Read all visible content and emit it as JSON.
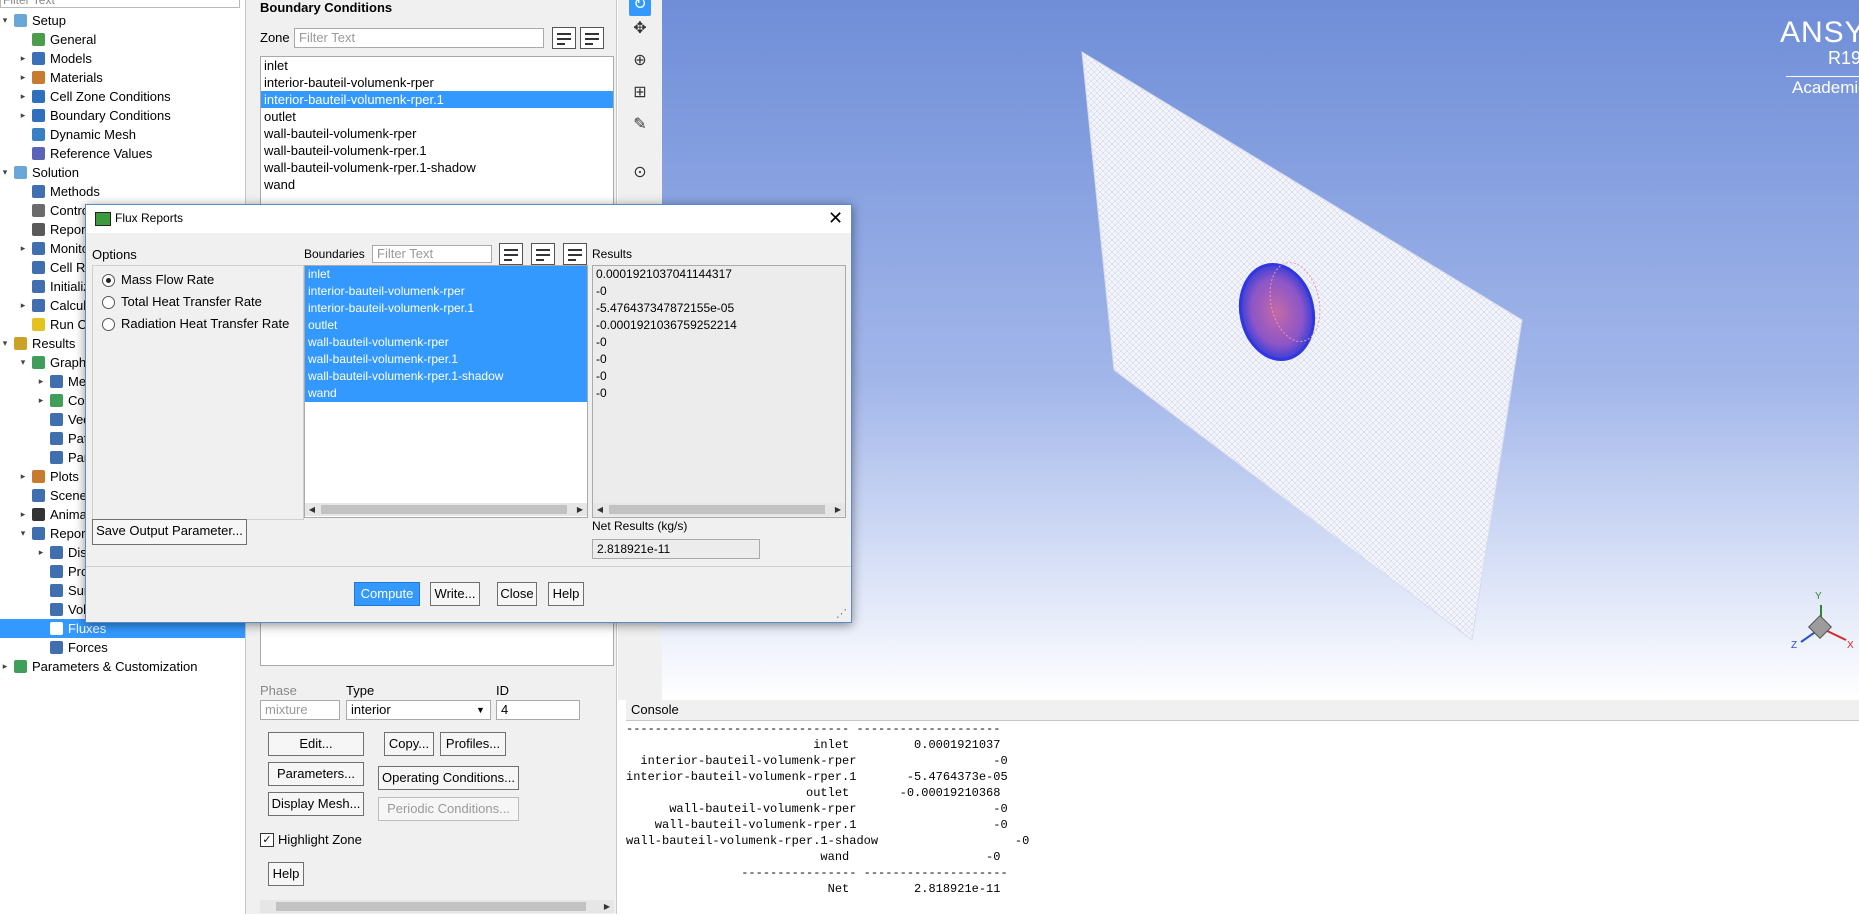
{
  "tree": {
    "filter_placeholder": "Filter Text",
    "items": [
      {
        "label": "Setup",
        "level": 0,
        "arrow": "▾",
        "color": "#6aa6d8",
        "selected": false
      },
      {
        "label": "General",
        "level": 1,
        "arrow": "",
        "color": "#4b9d4b",
        "selected": false
      },
      {
        "label": "Models",
        "level": 1,
        "arrow": "▸",
        "color": "#3b6fb8",
        "selected": false
      },
      {
        "label": "Materials",
        "level": 1,
        "arrow": "▸",
        "color": "#c77b30",
        "selected": false
      },
      {
        "label": "Cell Zone Conditions",
        "level": 1,
        "arrow": "▸",
        "color": "#2f6fbe",
        "selected": false
      },
      {
        "label": "Boundary Conditions",
        "level": 1,
        "arrow": "▸",
        "color": "#2f6fbe",
        "selected": false
      },
      {
        "label": "Dynamic Mesh",
        "level": 1,
        "arrow": "",
        "color": "#3a7fc4",
        "selected": false
      },
      {
        "label": "Reference Values",
        "level": 1,
        "arrow": "",
        "color": "#5a63b8",
        "selected": false
      },
      {
        "label": "Solution",
        "level": 0,
        "arrow": "▾",
        "color": "#6aa6d8",
        "selected": false
      },
      {
        "label": "Methods",
        "level": 1,
        "arrow": "",
        "color": "#3f6fae",
        "selected": false
      },
      {
        "label": "Controls",
        "level": 1,
        "arrow": "",
        "color": "#6b6b6b",
        "selected": false
      },
      {
        "label": "Report Definitions",
        "level": 1,
        "arrow": "",
        "color": "#5a5a5a",
        "selected": false
      },
      {
        "label": "Monitors",
        "level": 1,
        "arrow": "▸",
        "color": "#3f6fae",
        "selected": false
      },
      {
        "label": "Cell Registers",
        "level": 1,
        "arrow": "",
        "color": "#3f6fae",
        "selected": false
      },
      {
        "label": "Initialization",
        "level": 1,
        "arrow": "",
        "color": "#3f6fae",
        "selected": false
      },
      {
        "label": "Calculation Activities",
        "level": 1,
        "arrow": "▸",
        "color": "#3f6fae",
        "selected": false
      },
      {
        "label": "Run Calculation",
        "level": 1,
        "arrow": "",
        "color": "#e6c21e",
        "selected": false
      },
      {
        "label": "Results",
        "level": 0,
        "arrow": "▾",
        "color": "#c9a227",
        "selected": false
      },
      {
        "label": "Graphics",
        "level": 1,
        "arrow": "▾",
        "color": "#3f9e5a",
        "selected": false
      },
      {
        "label": "Mesh",
        "level": 2,
        "arrow": "▸",
        "color": "#3f6fae",
        "selected": false
      },
      {
        "label": "Contours",
        "level": 2,
        "arrow": "▸",
        "color": "#3f9e5a",
        "selected": false
      },
      {
        "label": "Vectors",
        "level": 2,
        "arrow": "",
        "color": "#3f6fae",
        "selected": false
      },
      {
        "label": "Pathlines",
        "level": 2,
        "arrow": "",
        "color": "#3f6fae",
        "selected": false
      },
      {
        "label": "Particle Tracks",
        "level": 2,
        "arrow": "",
        "color": "#3f6fae",
        "selected": false
      },
      {
        "label": "Plots",
        "level": 1,
        "arrow": "▸",
        "color": "#c77b30",
        "selected": false
      },
      {
        "label": "Scene",
        "level": 1,
        "arrow": "",
        "color": "#3f6fae",
        "selected": false
      },
      {
        "label": "Animations",
        "level": 1,
        "arrow": "▸",
        "color": "#333333",
        "selected": false
      },
      {
        "label": "Reports",
        "level": 1,
        "arrow": "▾",
        "color": "#3f6fae",
        "selected": false
      },
      {
        "label": "Discrete Phase",
        "level": 2,
        "arrow": "▸",
        "color": "#3f6fae",
        "selected": false
      },
      {
        "label": "Projected Areas",
        "level": 2,
        "arrow": "",
        "color": "#3f6fae",
        "selected": false
      },
      {
        "label": "Surface Integrals",
        "level": 2,
        "arrow": "",
        "color": "#3f6fae",
        "selected": false
      },
      {
        "label": "Volume Integrals",
        "level": 2,
        "arrow": "",
        "color": "#3f6fae",
        "selected": false
      },
      {
        "label": "Fluxes",
        "level": 2,
        "arrow": "",
        "color": "#ffffff",
        "selected": true
      },
      {
        "label": "Forces",
        "level": 2,
        "arrow": "",
        "color": "#3f6fae",
        "selected": false
      },
      {
        "label": "Parameters & Customization",
        "level": 0,
        "arrow": "▸",
        "color": "#3f9e5a",
        "selected": false
      }
    ]
  },
  "bc_panel": {
    "title": "Boundary Conditions",
    "zone_label": "Zone",
    "filter_placeholder": "Filter Text",
    "zones": [
      {
        "name": "inlet",
        "selected": false
      },
      {
        "name": "interior-bauteil-volumenk-rper",
        "selected": false
      },
      {
        "name": "interior-bauteil-volumenk-rper.1",
        "selected": true
      },
      {
        "name": "outlet",
        "selected": false
      },
      {
        "name": "wall-bauteil-volumenk-rper",
        "selected": false
      },
      {
        "name": "wall-bauteil-volumenk-rper.1",
        "selected": false
      },
      {
        "name": "wall-bauteil-volumenk-rper.1-shadow",
        "selected": false
      },
      {
        "name": "wand",
        "selected": false
      }
    ],
    "phase_label": "Phase",
    "phase_value": "mixture",
    "type_label": "Type",
    "type_value": "interior",
    "id_label": "ID",
    "id_value": "4",
    "edit_button": "Edit...",
    "copy_button": "Copy...",
    "profiles_button": "Profiles...",
    "parameters_button": "Parameters...",
    "operating_conditions_button": "Operating Conditions...",
    "display_mesh_button": "Display Mesh...",
    "periodic_conditions_button": "Periodic Conditions...",
    "highlight_zone_label": "Highlight Zone",
    "highlight_zone_checked": true,
    "help_button": "Help"
  },
  "viewport": {
    "brand": "ANSYS",
    "version": "R19",
    "edition": "Academic",
    "triad_labels": {
      "x": "X",
      "y": "Y",
      "z": "Z"
    }
  },
  "dialog": {
    "title": "Flux Reports",
    "options_label": "Options",
    "options": [
      {
        "label": "Mass Flow Rate",
        "checked": true
      },
      {
        "label": "Total Heat Transfer Rate",
        "checked": false
      },
      {
        "label": "Radiation Heat Transfer Rate",
        "checked": false
      }
    ],
    "boundaries_label": "Boundaries",
    "filter_placeholder": "Filter Text",
    "results_label": "Results",
    "boundaries": [
      "inlet",
      "interior-bauteil-volumenk-rper",
      "interior-bauteil-volumenk-rper.1",
      "outlet",
      "wall-bauteil-volumenk-rper",
      "wall-bauteil-volumenk-rper.1",
      "wall-bauteil-volumenk-rper.1-shadow",
      "wand"
    ],
    "results": [
      "0.0001921037041144317",
      "-0",
      "-5.476437347872155e-05",
      "-0.0001921036759252214",
      "-0",
      "-0",
      "-0",
      "-0"
    ],
    "save_output_button": "Save Output Parameter...",
    "net_results_label": "Net Results (kg/s)",
    "net_results_value": "2.818921e-11",
    "compute_button": "Compute",
    "write_button": "Write...",
    "close_button": "Close",
    "help_button": "Help"
  },
  "console": {
    "title": "Console",
    "lines": [
      "------------------------------- --------------------",
      "                          inlet         0.0001921037",
      "  interior-bauteil-volumenk-rper                   -0",
      "interior-bauteil-volumenk-rper.1       -5.4764373e-05",
      "                         outlet       -0.00019210368",
      "      wall-bauteil-volumenk-rper                   -0",
      "    wall-bauteil-volumenk-rper.1                   -0",
      "wall-bauteil-volumenk-rper.1-shadow                   -0",
      "                           wand                   -0",
      "                ---------------- --------------------",
      "                            Net         2.818921e-11"
    ]
  }
}
